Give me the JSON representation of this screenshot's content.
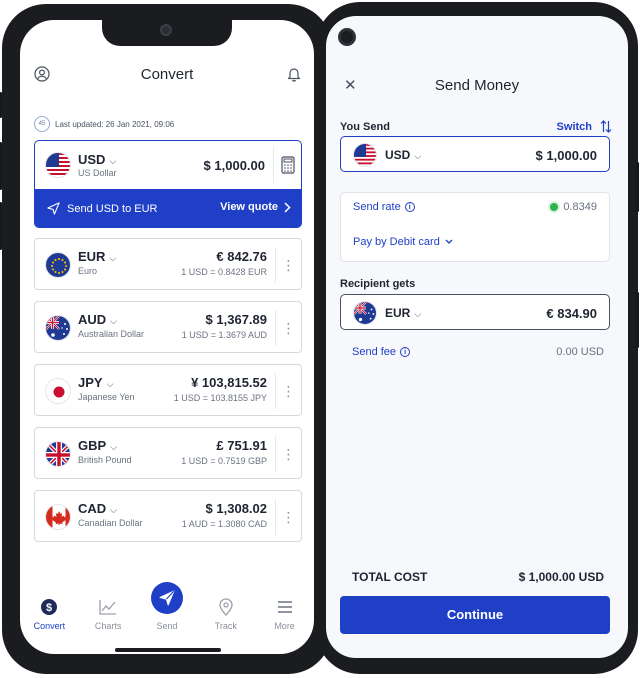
{
  "converter": {
    "title": "Convert",
    "last_updated": "Last updated: 26 Jan 2021, 09:06",
    "timer_value": "45",
    "base": {
      "code": "USD",
      "name": "US Dollar",
      "amount": "$ 1,000.00",
      "send_label": "Send USD to EUR",
      "view_quote_label": "View quote"
    },
    "rows": [
      {
        "code": "EUR",
        "name": "Euro",
        "amount": "€ 842.76",
        "rate": "1 USD = 0.8428 EUR"
      },
      {
        "code": "AUD",
        "name": "Australian Dollar",
        "amount": "$ 1,367.89",
        "rate": "1 USD = 1.3679 AUD"
      },
      {
        "code": "JPY",
        "name": "Japanese Yen",
        "amount": "¥ 103,815.52",
        "rate": "1 USD = 103.8155 JPY"
      },
      {
        "code": "GBP",
        "name": "British Pound",
        "amount": "£ 751.91",
        "rate": "1 USD = 0.7519 GBP"
      },
      {
        "code": "CAD",
        "name": "Canadian Dollar",
        "amount": "$ 1,308.02",
        "rate": "1 AUD = 1.3080 CAD"
      }
    ],
    "tabs": [
      {
        "label": "Convert",
        "icon": "convert-icon",
        "active": true
      },
      {
        "label": "Charts",
        "icon": "chart-icon",
        "active": false
      },
      {
        "label": "Send",
        "icon": "send-icon",
        "active": false
      },
      {
        "label": "Track",
        "icon": "location-pin-icon",
        "active": false
      },
      {
        "label": "More",
        "icon": "menu-icon",
        "active": false
      }
    ],
    "accent": "#1f3fc7"
  },
  "send": {
    "title": "Send Money",
    "you_send_label": "You Send",
    "switch_label": "Switch",
    "send_currency": "USD",
    "send_amount": "$ 1,000.00",
    "send_rate_label": "Send rate",
    "send_rate_value": "0.8349",
    "pay_by_label": "Pay by Debit card",
    "recipient_label": "Recipient gets",
    "recipient_currency": "EUR",
    "recipient_amount": "€ 834.90",
    "send_fee_label": "Send fee",
    "send_fee_value": "0.00 USD",
    "total_label": "TOTAL COST",
    "total_value": "$ 1,000.00 USD",
    "continue_label": "Continue"
  }
}
